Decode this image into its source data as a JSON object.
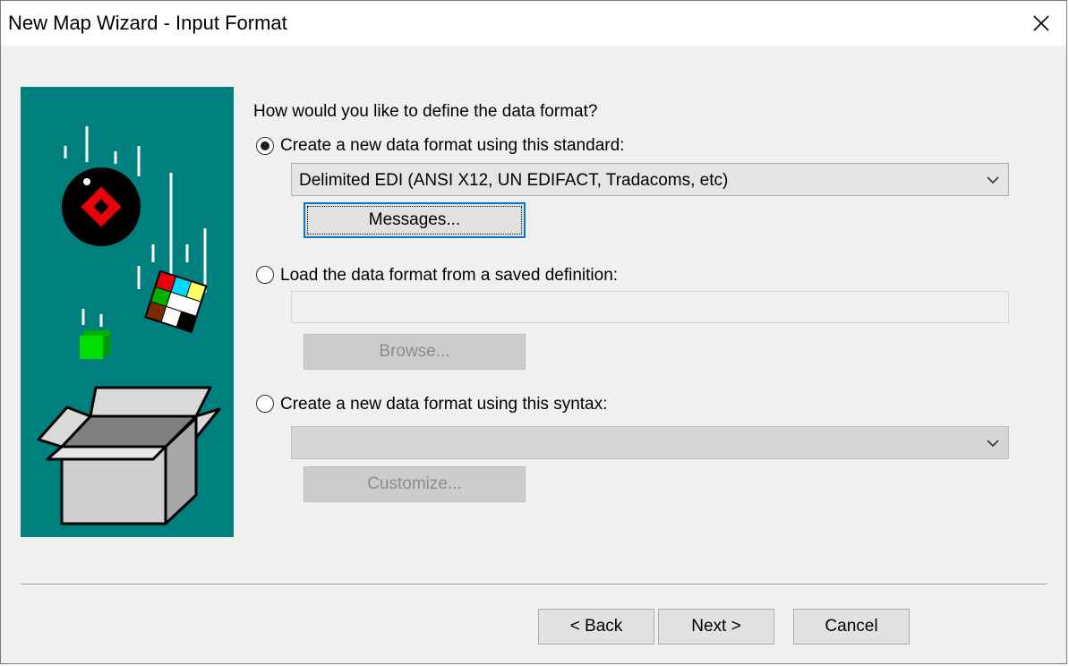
{
  "window": {
    "title": "New Map Wizard - Input Format"
  },
  "question": "How would you like to define the data format?",
  "options": [
    {
      "label": "Create a new data format using this standard:",
      "selected": true
    },
    {
      "label": "Load the data format from a saved definition:",
      "selected": false
    },
    {
      "label": "Create a new data format using this syntax:",
      "selected": false
    }
  ],
  "standard_combo": {
    "value": "Delimited EDI (ANSI X12, UN EDIFACT, Tradacoms, etc)"
  },
  "saved_definition": {
    "value": ""
  },
  "syntax_combo": {
    "value": ""
  },
  "buttons": {
    "messages": "Messages...",
    "browse": "Browse...",
    "customize": "Customize...",
    "back": "< Back",
    "next": "Next >",
    "cancel": "Cancel"
  },
  "colors": {
    "art_background": "#007f7f",
    "focus": "#0078d7",
    "face": "#f0f0f0"
  }
}
